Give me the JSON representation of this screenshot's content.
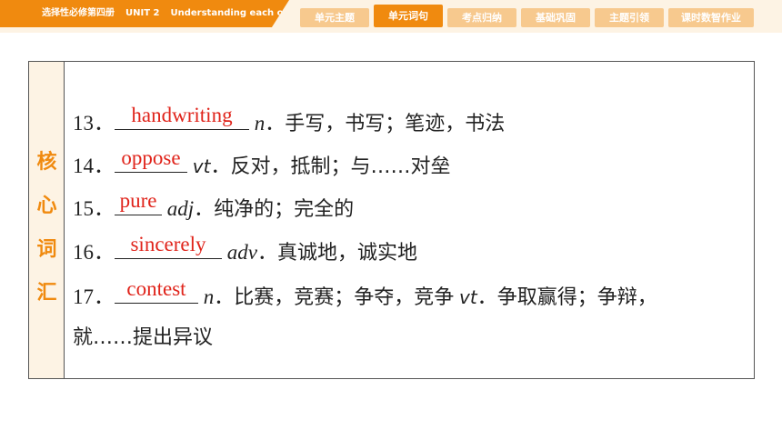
{
  "header": {
    "book_title": "选择性必修第四册",
    "unit": "UNIT 2",
    "unit_title": "Understanding each other"
  },
  "tabs": [
    {
      "label": "单元主题",
      "active": false
    },
    {
      "label": "单元词句",
      "active": true
    },
    {
      "label": "考点归纳",
      "active": false
    },
    {
      "label": "基础巩固",
      "active": false
    },
    {
      "label": "主题引领",
      "active": false
    },
    {
      "label": "课时数智作业",
      "active": false
    }
  ],
  "side_label": [
    "核",
    "心",
    "词",
    "汇"
  ],
  "items": [
    {
      "num": "13．",
      "answer": "handwriting",
      "pos": "n",
      "meaning": "．手写，书写；笔迹，书法"
    },
    {
      "num": "14．",
      "answer": "oppose",
      "pos": "vt",
      "meaning": "．反对，抵制；与……对垒"
    },
    {
      "num": "15．",
      "answer": "pure",
      "pos": "adj",
      "meaning": "．纯净的；完全的"
    },
    {
      "num": "16．",
      "answer": "sincerely",
      "pos": "adv",
      "meaning": "．真诚地，诚实地"
    },
    {
      "num": "17．",
      "answer": "contest",
      "pos": "n",
      "meaning": "．比赛，竞赛；争夺，竞争",
      "pos2": "vt",
      "meaning2": "．争取赢得；争辩，",
      "continuation": "就……提出异议"
    }
  ],
  "colors": {
    "accent": "#f08a0f",
    "tab_inactive": "#f7c98e",
    "answer": "#e0241b",
    "background_tint": "#fdf3e4"
  }
}
